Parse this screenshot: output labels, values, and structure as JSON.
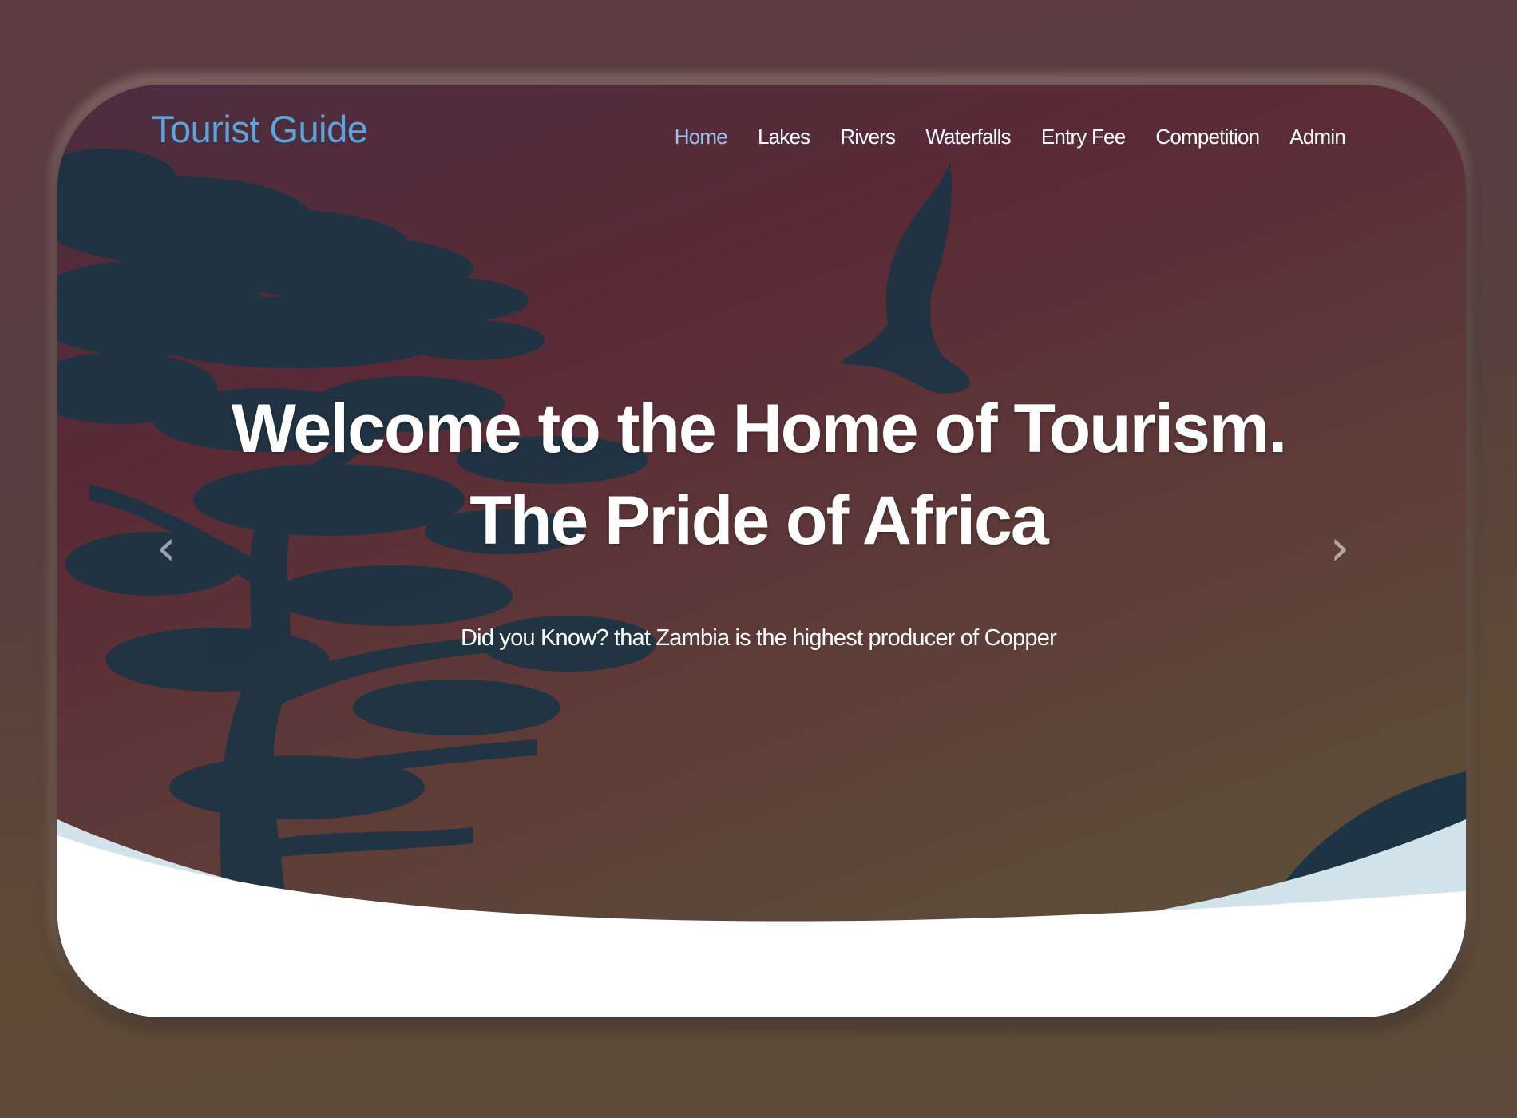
{
  "brand": "Tourist Guide",
  "nav": {
    "items": [
      {
        "label": "Home",
        "active": true
      },
      {
        "label": "Lakes"
      },
      {
        "label": "Rivers"
      },
      {
        "label": "Waterfalls"
      },
      {
        "label": "Entry Fee"
      },
      {
        "label": "Competition"
      },
      {
        "label": "Admin"
      }
    ]
  },
  "hero": {
    "title_line1": "Welcome to the Home of Tourism.",
    "title_line2": "The Pride of Africa",
    "subtitle": "Did you Know? that Zambia is the highest producer of Copper",
    "prev_icon": "‹",
    "next_icon": "›"
  },
  "colors": {
    "brand": "#5aa6dc",
    "nav_active": "#9fc3e6",
    "silhouette": "#1c3444",
    "wave_light": "#d3e3ec",
    "wave_white": "#ffffff"
  },
  "icons": [
    "chevron-left-icon",
    "chevron-right-icon"
  ]
}
